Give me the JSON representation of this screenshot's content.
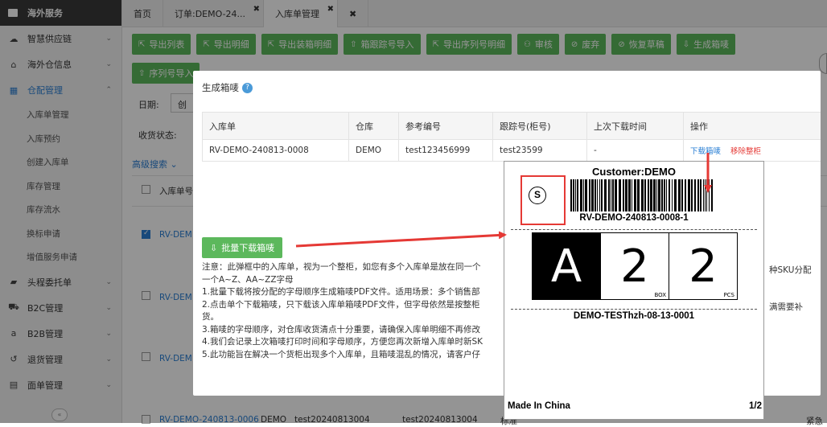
{
  "sidebar": {
    "header": "海外服务",
    "items": [
      {
        "label": "智慧供应链",
        "icon": "cloud-icon"
      },
      {
        "label": "海外仓信息",
        "icon": "home-icon"
      },
      {
        "label": "仓配管理",
        "icon": "grid-icon"
      },
      {
        "label": "头程委托单",
        "icon": "briefcase-icon"
      },
      {
        "label": "B2C管理",
        "icon": "cart-icon"
      },
      {
        "label": "B2B管理",
        "icon": "amazon-icon"
      },
      {
        "label": "退货管理",
        "icon": "undo-icon"
      },
      {
        "label": "面单管理",
        "icon": "document-icon"
      }
    ],
    "subitems": [
      "入库单管理",
      "入库预约",
      "创建入库单",
      "库存管理",
      "库存流水",
      "换标申请",
      "增值服务申请"
    ],
    "collapse": "«"
  },
  "tabs": [
    {
      "label": "首页"
    },
    {
      "label": "订单:DEMO-24..."
    },
    {
      "label": "入库单管理"
    }
  ],
  "toolbar": {
    "row1": [
      "导出列表",
      "导出明细",
      "导出装箱明细",
      "箱跟踪号导入",
      "导出序列号明细",
      "审核",
      "废弃",
      "恢复草稿",
      "生成箱唛"
    ],
    "row2": [
      "序列号导入"
    ]
  },
  "filters": {
    "date_label": "日期:",
    "date_value": "创",
    "status_label": "收货状态:",
    "advanced": "高级搜索"
  },
  "background_table": {
    "header": "入库单号",
    "rows": [
      "RV-DEM",
      "RV-DEM",
      "RV-DEM",
      "RV-DEM"
    ],
    "last_row": [
      "RV-DEMO-240813-0006",
      "DEMO",
      "test20240813004",
      "test20240813004",
      "标准",
      "紧急"
    ]
  },
  "modal": {
    "title": "生成箱唛",
    "columns": [
      "入库单",
      "仓库",
      "参考编号",
      "跟踪号(柜号)",
      "上次下载时间",
      "操作"
    ],
    "row": {
      "inbound": "RV-DEMO-240813-0008",
      "warehouse": "DEMO",
      "reference": "test123456999",
      "tracking": "test23599",
      "last_download": "-",
      "download_action": "下载箱唛",
      "remove_action": "移除整柜"
    },
    "batch_button": "批量下载箱唛",
    "notes": [
      "注意：此弹框中的入库单，视为一个整柜，如您有多个入库单是放在同一个",
      "一个A~Z、AA~ZZ字母",
      "1.批量下载将按分配的字母顺序生成箱唛PDF文件。适用场景：多个销售部",
      "2.点击单个下载箱唛，只下载该入库单箱唛PDF文件，但字母依然是按整柜",
      "货。",
      "3.箱唛的字母顺序，对仓库收货清点十分重要，请确保入库单明细不再修改",
      "4.我们会记录上次箱唛打印时间和字母顺序，方便您再次新增入库单时新SK",
      "5.此功能旨在解决一个货柜出现多个入库单，且箱唛混乱的情况，请客户仔"
    ],
    "notes_right": [
      "种SKU分配",
      "满需要补"
    ]
  },
  "label": {
    "customer": "Customer:DEMO",
    "symbol": "S",
    "barcode_text": "RV-DEMO-240813-0008-1",
    "letter": "A",
    "box_count": "2",
    "box_unit": "BOX",
    "pcs_count": "2",
    "pcs_unit": "PCS",
    "sku": "DEMO-TESThzh-08-13-0001",
    "origin": "Made In China",
    "page": "1/2"
  },
  "colors": {
    "green": "#5cb85c",
    "blue": "#2a7fd4",
    "red_annotation": "#e53935"
  }
}
